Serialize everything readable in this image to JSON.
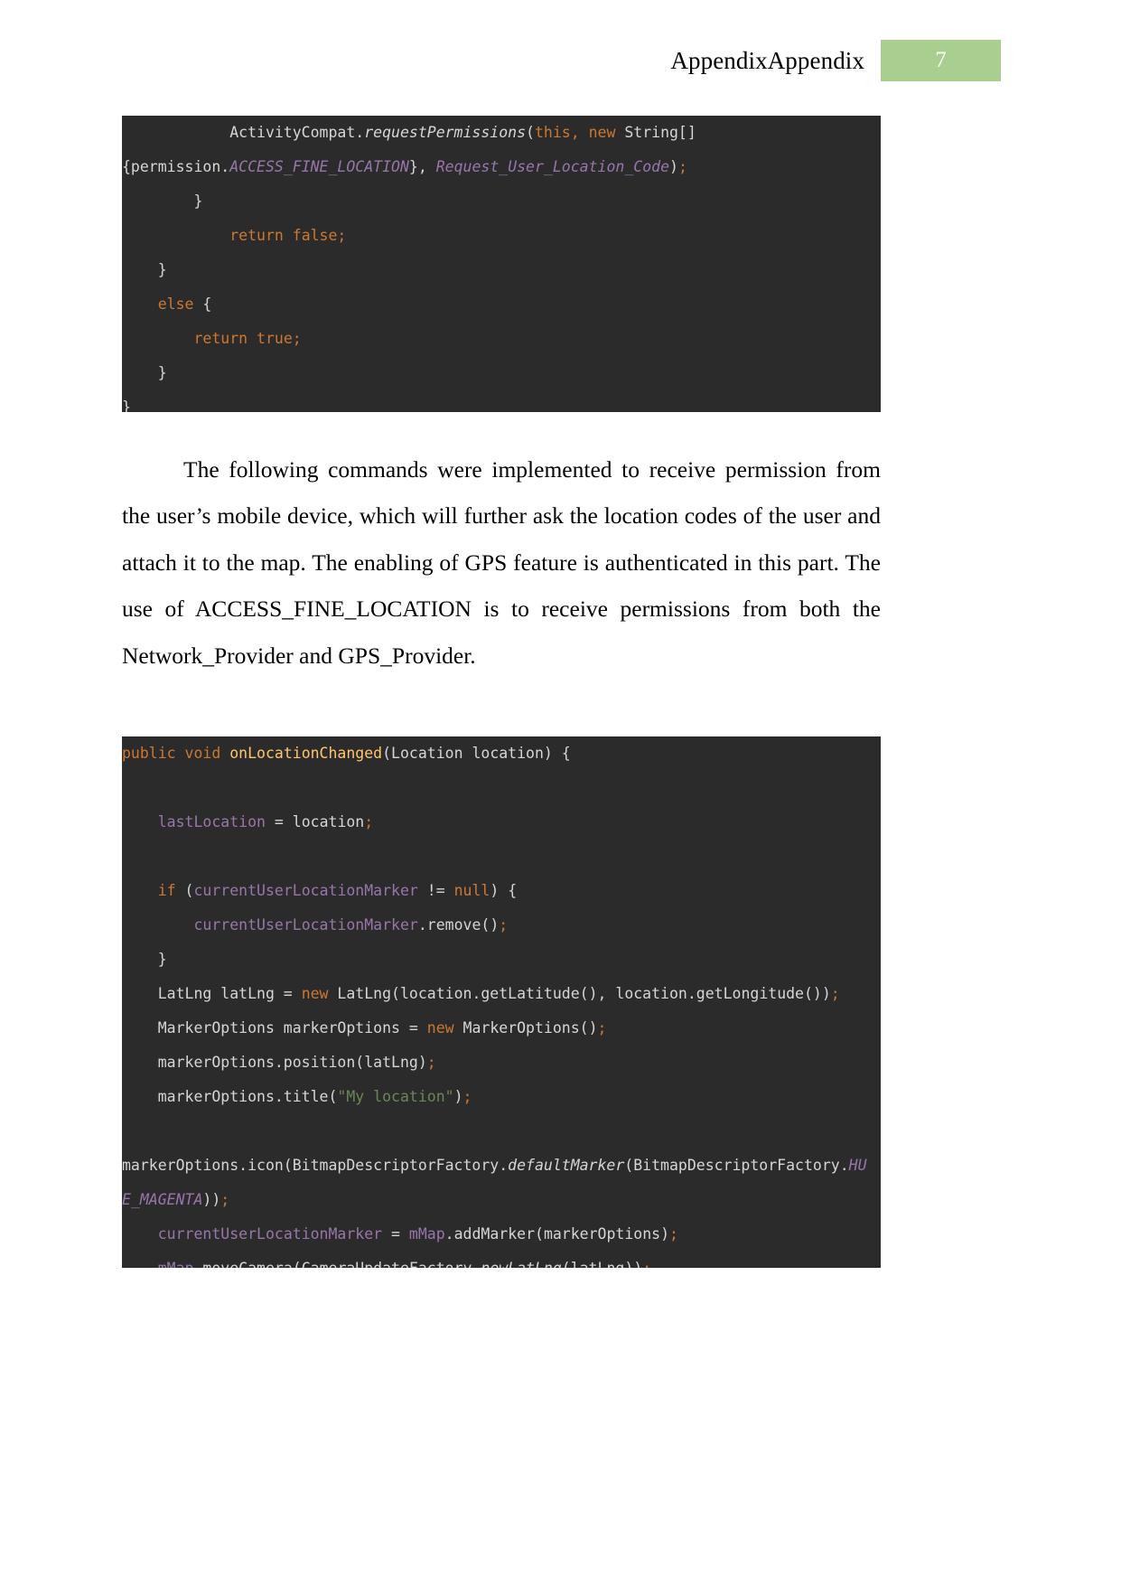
{
  "header": {
    "title": "AppendixAppendix",
    "page_number": "7",
    "badge_color": "#a8cf8f"
  },
  "code_block_1": {
    "background": "#2b2b2b",
    "lines": [
      [
        {
          "t": "            ActivityCompat.",
          "c": "plain"
        },
        {
          "t": "requestPermissions",
          "c": "static"
        },
        {
          "t": "(",
          "c": "plain"
        },
        {
          "t": "this, ",
          "c": "kw"
        },
        {
          "t": "new ",
          "c": "kw"
        },
        {
          "t": "String[]",
          "c": "plain"
        }
      ],
      [
        {
          "t": "{permission.",
          "c": "plain"
        },
        {
          "t": "ACCESS_FINE_LOCATION",
          "c": "const"
        },
        {
          "t": "}, ",
          "c": "plain"
        },
        {
          "t": "Request_User_Location_Code",
          "c": "const"
        },
        {
          "t": ")",
          "c": "plain"
        },
        {
          "t": ";",
          "c": "punct"
        }
      ],
      [
        {
          "t": "        }",
          "c": "plain"
        }
      ],
      [
        {
          "t": "            ",
          "c": "plain"
        },
        {
          "t": "return false;",
          "c": "kw"
        }
      ],
      [
        {
          "t": "    }",
          "c": "plain"
        }
      ],
      [
        {
          "t": "    ",
          "c": "plain"
        },
        {
          "t": "else",
          "c": "kw"
        },
        {
          "t": " {",
          "c": "plain"
        }
      ],
      [
        {
          "t": "        ",
          "c": "plain"
        },
        {
          "t": "return true;",
          "c": "kw"
        }
      ],
      [
        {
          "t": "    }",
          "c": "plain"
        }
      ],
      [
        {
          "t": "}",
          "c": "plain"
        }
      ]
    ]
  },
  "paragraph": {
    "text": "The following commands were implemented to receive permission from the user’s mobile device, which will further ask the location codes of the user and attach it to the map. The enabling of GPS feature is authenticated in this part. The use of ACCESS_FINE_LOCATION is to receive permissions from both the Network_Provider and GPS_Provider."
  },
  "code_block_2": {
    "background": "#2b2b2b",
    "lines": [
      [
        {
          "t": "public ",
          "c": "kw"
        },
        {
          "t": "void ",
          "c": "kw"
        },
        {
          "t": "onLocationChanged",
          "c": "method"
        },
        {
          "t": "(Location location) {",
          "c": "plain"
        }
      ],
      [
        {
          "t": "",
          "c": "plain"
        }
      ],
      [
        {
          "t": "    ",
          "c": "plain"
        },
        {
          "t": "lastLocation",
          "c": "field"
        },
        {
          "t": " = location",
          "c": "plain"
        },
        {
          "t": ";",
          "c": "punct"
        }
      ],
      [
        {
          "t": "",
          "c": "plain"
        }
      ],
      [
        {
          "t": "    ",
          "c": "plain"
        },
        {
          "t": "if",
          "c": "kw"
        },
        {
          "t": " (",
          "c": "plain"
        },
        {
          "t": "currentUserLocationMarker",
          "c": "field"
        },
        {
          "t": " != ",
          "c": "plain"
        },
        {
          "t": "null",
          "c": "kw"
        },
        {
          "t": ") {",
          "c": "plain"
        }
      ],
      [
        {
          "t": "        ",
          "c": "plain"
        },
        {
          "t": "currentUserLocationMarker",
          "c": "field"
        },
        {
          "t": ".remove()",
          "c": "plain"
        },
        {
          "t": ";",
          "c": "punct"
        }
      ],
      [
        {
          "t": "    }",
          "c": "plain"
        }
      ],
      [
        {
          "t": "    LatLng latLng = ",
          "c": "plain"
        },
        {
          "t": "new",
          "c": "kw"
        },
        {
          "t": " LatLng(location.getLatitude(), location.getLongitude())",
          "c": "plain"
        },
        {
          "t": ";",
          "c": "punct"
        }
      ],
      [
        {
          "t": "    MarkerOptions markerOptions = ",
          "c": "plain"
        },
        {
          "t": "new",
          "c": "kw"
        },
        {
          "t": " MarkerOptions()",
          "c": "plain"
        },
        {
          "t": ";",
          "c": "punct"
        }
      ],
      [
        {
          "t": "    markerOptions.position(latLng)",
          "c": "plain"
        },
        {
          "t": ";",
          "c": "punct"
        }
      ],
      [
        {
          "t": "    markerOptions.title(",
          "c": "plain"
        },
        {
          "t": "\"My location\"",
          "c": "string"
        },
        {
          "t": ")",
          "c": "plain"
        },
        {
          "t": ";",
          "c": "punct"
        }
      ],
      [
        {
          "t": "",
          "c": "plain"
        }
      ],
      [
        {
          "t": "markerOptions.icon(BitmapDescriptorFactory.",
          "c": "plain"
        },
        {
          "t": "defaultMarker",
          "c": "static"
        },
        {
          "t": "(BitmapDescriptorFactory.",
          "c": "plain"
        },
        {
          "t": "HU",
          "c": "const"
        }
      ],
      [
        {
          "t": "E_MAGENTA",
          "c": "const"
        },
        {
          "t": "))",
          "c": "plain"
        },
        {
          "t": ";",
          "c": "punct"
        }
      ],
      [
        {
          "t": "    ",
          "c": "plain"
        },
        {
          "t": "currentUserLocationMarker",
          "c": "field"
        },
        {
          "t": " = ",
          "c": "plain"
        },
        {
          "t": "mMap",
          "c": "field"
        },
        {
          "t": ".addMarker(markerOptions)",
          "c": "plain"
        },
        {
          "t": ";",
          "c": "punct"
        }
      ],
      [
        {
          "t": "    ",
          "c": "plain"
        },
        {
          "t": "mMap",
          "c": "field"
        },
        {
          "t": ".moveCamera(CameraUpdateFactory.",
          "c": "plain"
        },
        {
          "t": "newLatLng",
          "c": "static"
        },
        {
          "t": "(latLng))",
          "c": "plain"
        },
        {
          "t": ";",
          "c": "punct"
        }
      ]
    ]
  }
}
